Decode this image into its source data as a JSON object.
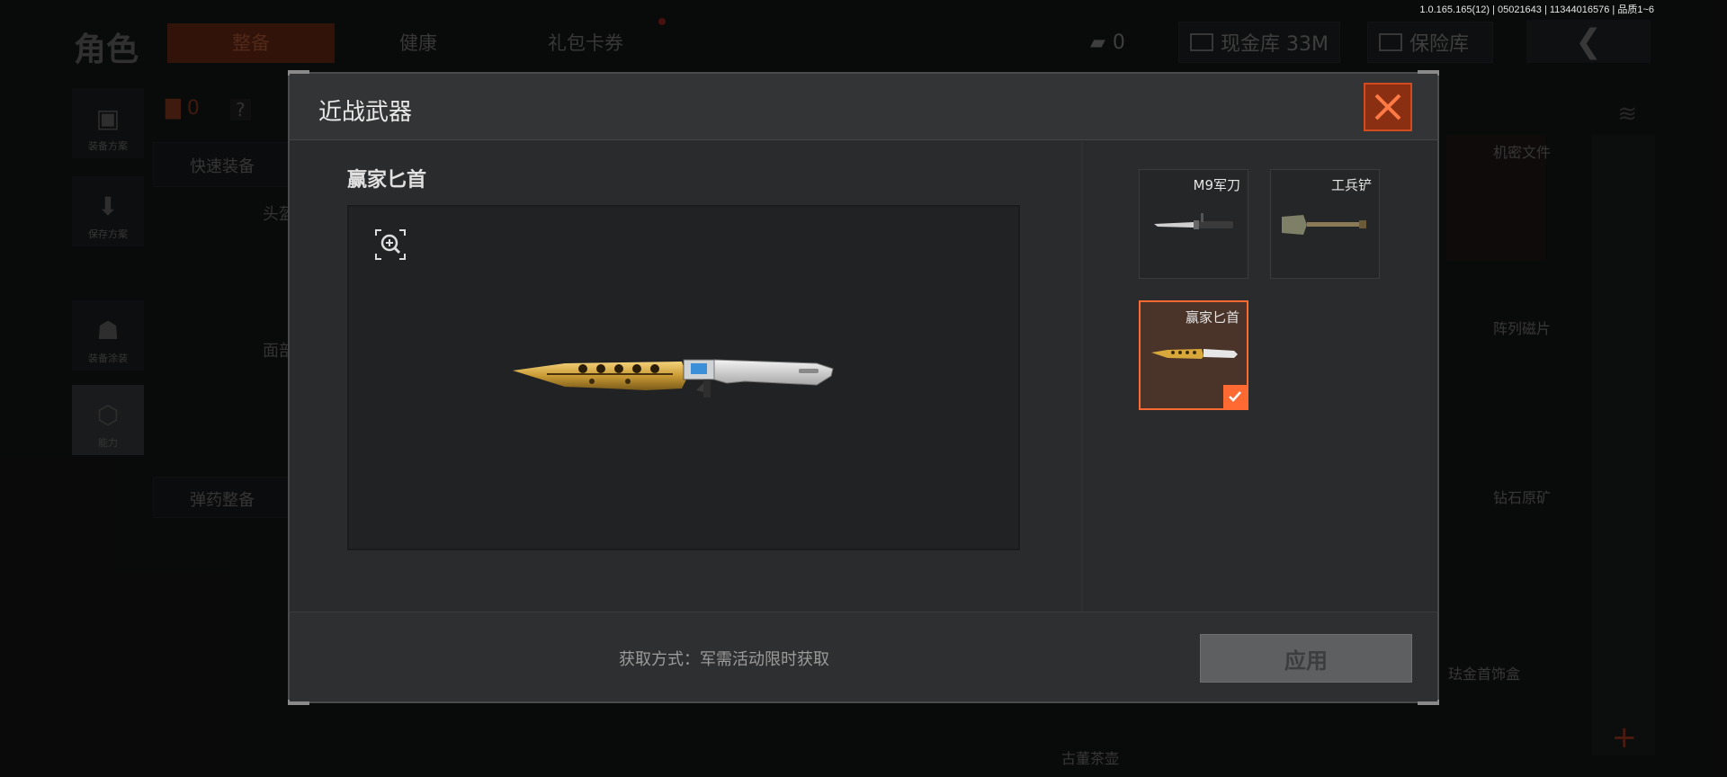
{
  "version": "1.0.165.165(12) | 05021643 | 11344016576 | 品质1~6",
  "background": {
    "title": "角色",
    "tabs": [
      {
        "label": "整备",
        "active": true
      },
      {
        "label": "健康",
        "active": false
      },
      {
        "label": "礼包卡券",
        "active": false
      }
    ],
    "currency_count": "0",
    "cash_storage": "现金库 33M",
    "insurance": "保险库",
    "left_nav": [
      {
        "label": "装备方案",
        "icon": "vest-icon"
      },
      {
        "label": "保存方案",
        "icon": "download-icon"
      },
      {
        "label": "装备涂装",
        "icon": "helmet-icon"
      },
      {
        "label": "能力",
        "icon": "lightning-hex-icon"
      }
    ],
    "badge_count": "0",
    "quick_equip": "快速装备",
    "slot_head": "头盔",
    "slot_face": "面部",
    "ammo_prep": "弹药整备",
    "right_labels": [
      "机密文件",
      "阵列磁片",
      "钻石原矿",
      "珐金首饰盒",
      "古董茶壶"
    ]
  },
  "modal": {
    "title": "近战武器",
    "selected_name": "赢家匕首",
    "items": [
      {
        "label": "M9军刀",
        "icon": "bayonet-icon",
        "selected": false
      },
      {
        "label": "工兵铲",
        "icon": "shovel-icon",
        "selected": false
      },
      {
        "label": "赢家匕首",
        "icon": "gold-dagger-icon",
        "selected": true
      }
    ],
    "acquire_text": "获取方式：军需活动限时获取",
    "apply_label": "应用"
  },
  "colors": {
    "accent": "#ff6a33",
    "close_bg": "#8b2f13",
    "modal_bg": "#2a2b2c"
  }
}
